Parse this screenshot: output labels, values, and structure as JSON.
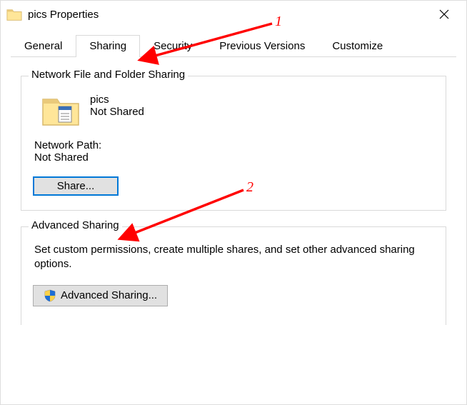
{
  "window": {
    "title": "pics Properties"
  },
  "tabs": [
    {
      "label": "General",
      "active": false
    },
    {
      "label": "Sharing",
      "active": true
    },
    {
      "label": "Security",
      "active": false
    },
    {
      "label": "Previous Versions",
      "active": false
    },
    {
      "label": "Customize",
      "active": false
    }
  ],
  "network_sharing": {
    "group_title": "Network File and Folder Sharing",
    "folder_name": "pics",
    "share_status": "Not Shared",
    "path_label": "Network Path:",
    "path_value": "Not Shared",
    "share_button": "Share..."
  },
  "advanced_sharing": {
    "group_title": "Advanced Sharing",
    "description": "Set custom permissions, create multiple shares, and set other advanced sharing options.",
    "button": "Advanced Sharing..."
  },
  "annotations": {
    "a1": "1",
    "a2": "2"
  }
}
